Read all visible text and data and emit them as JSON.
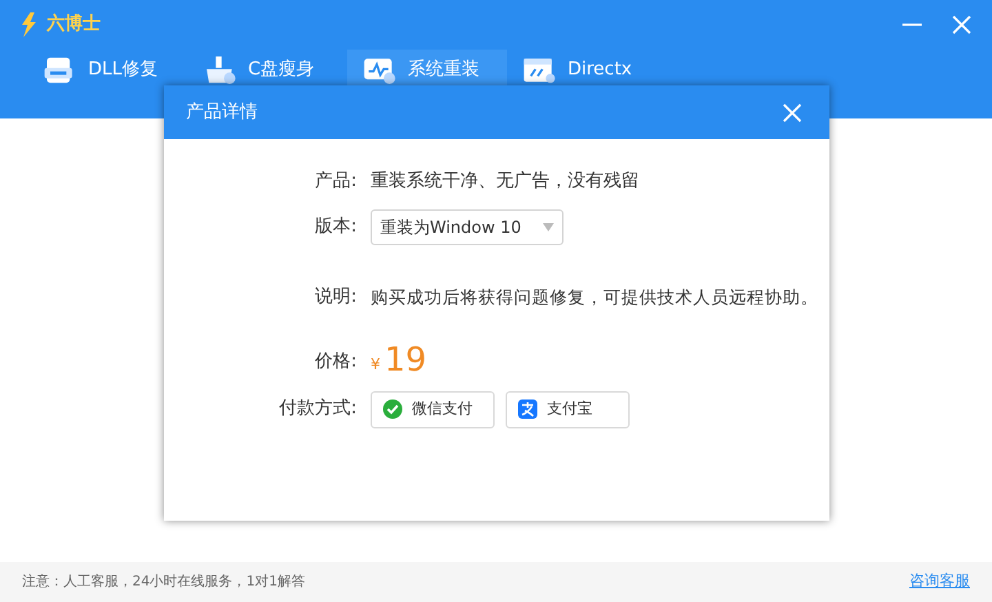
{
  "app": {
    "title": "六博士"
  },
  "tabs": [
    {
      "label": "DLL修复",
      "selected": false
    },
    {
      "label": "C盘瘦身",
      "selected": false
    },
    {
      "label": "系统重装",
      "selected": true
    },
    {
      "label": "Directx",
      "selected": false
    }
  ],
  "dialog": {
    "title": "产品详情",
    "product_label": "产品:",
    "product": "重装系统干净、无广告，没有残留",
    "version_label": "版本:",
    "version": "重装为Window 10",
    "note_label": "说明:",
    "note": "购买成功后将获得问题修复，可提供技术人员远程协助。",
    "price_label": "价格:",
    "currency": "¥",
    "price": "19",
    "payment_label": "付款方式:",
    "payments": [
      {
        "label": "微信支付",
        "kind": "wechat"
      },
      {
        "label": "支付宝",
        "kind": "alipay"
      }
    ]
  },
  "footer": {
    "notice": "注意：人工客服，24小时在线服务，1对1解答",
    "link": "咨询客服"
  }
}
